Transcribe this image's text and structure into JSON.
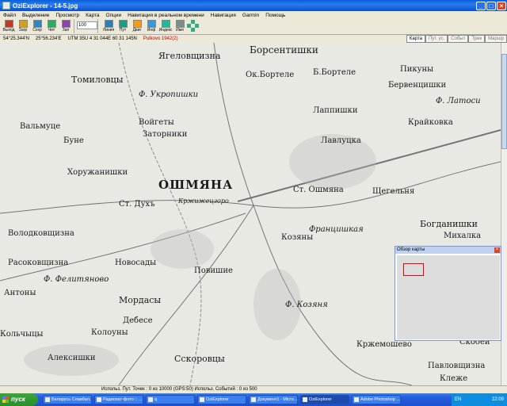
{
  "window": {
    "title": "OziExplorer - 14-5.jpg"
  },
  "menu": [
    "Файл",
    "Выделение",
    "Просмотр",
    "Карта",
    "Опции",
    "Навигация в реальном времени",
    "Навигация",
    "Garmin",
    "Помощь"
  ],
  "toolbar": {
    "buttons": [
      {
        "label": "Выход",
        "color": "#c0392b"
      },
      {
        "label": "Загр",
        "color": "#d4a017"
      },
      {
        "label": "Сохр",
        "color": "#2e86c1"
      },
      {
        "label": "Чит",
        "color": "#27ae60"
      },
      {
        "label": "Зап",
        "color": "#8e44ad"
      }
    ],
    "view_buttons": [
      {
        "label": "Линия",
        "color": "#2980b9"
      },
      {
        "label": "Пут",
        "color": "#16a085"
      },
      {
        "label": "Двиг",
        "color": "#f39c12"
      },
      {
        "label": "Инф",
        "color": "#3498db"
      },
      {
        "label": "Индекс",
        "color": "#1abc9c"
      },
      {
        "label": "Имя",
        "color": "#7f8c8d"
      }
    ],
    "zoom": "100"
  },
  "info": {
    "lat": "54°25.344'N",
    "lon": "25°56.234'E",
    "utm": "UTM 35U 4 31 044E 60 31 145N",
    "datum": "Pulkovo 1942(2)"
  },
  "right_tabs": [
    "Карта",
    "Пут. ус.",
    "Событ",
    "Трек",
    "Маршр"
  ],
  "map": {
    "labels": [
      {
        "text": "Ягеловщизна",
        "cls": ""
      },
      {
        "text": "Борсентишки",
        "cls": ""
      },
      {
        "text": "Томиловцы",
        "cls": ""
      },
      {
        "text": "Ф. Укропишки",
        "cls": "italic"
      },
      {
        "text": "Ок.Бортеле",
        "cls": ""
      },
      {
        "text": "Б.Бортеле",
        "cls": ""
      },
      {
        "text": "Пикуны",
        "cls": ""
      },
      {
        "text": "Бервенцишки",
        "cls": ""
      },
      {
        "text": "Ф. Латоси",
        "cls": "italic"
      },
      {
        "text": "Вальмуце",
        "cls": ""
      },
      {
        "text": "Буне",
        "cls": ""
      },
      {
        "text": "Войгеты",
        "cls": ""
      },
      {
        "text": "Заторники",
        "cls": ""
      },
      {
        "text": "Лаппишки",
        "cls": ""
      },
      {
        "text": "Лавлуцка",
        "cls": ""
      },
      {
        "text": "Крайковка",
        "cls": ""
      },
      {
        "text": "Хоружанишки",
        "cls": ""
      },
      {
        "text": "ОШМЯНА",
        "cls": "big"
      },
      {
        "text": "Ст. Ошмяна",
        "cls": ""
      },
      {
        "text": "Щегельня",
        "cls": ""
      },
      {
        "text": "Ст. Духъ",
        "cls": ""
      },
      {
        "text": "Кржижецгоро",
        "cls": "italic"
      },
      {
        "text": "Богданишки",
        "cls": ""
      },
      {
        "text": "Михалка",
        "cls": ""
      },
      {
        "text": "Володковщизна",
        "cls": ""
      },
      {
        "text": "Францишкая",
        "cls": "italic"
      },
      {
        "text": "Козяны",
        "cls": ""
      },
      {
        "text": "Расоковщизна",
        "cls": ""
      },
      {
        "text": "Новосады",
        "cls": ""
      },
      {
        "text": "Ф. Фелитяново",
        "cls": "italic"
      },
      {
        "text": "Повишие",
        "cls": ""
      },
      {
        "text": "Антоны",
        "cls": ""
      },
      {
        "text": "Мордасы",
        "cls": ""
      },
      {
        "text": "Дебесе",
        "cls": ""
      },
      {
        "text": "Кольчыцы",
        "cls": ""
      },
      {
        "text": "Колоуны",
        "cls": ""
      },
      {
        "text": "Алексишки",
        "cls": ""
      },
      {
        "text": "Сскоровцы",
        "cls": ""
      },
      {
        "text": "Ф. Козяня",
        "cls": "italic"
      },
      {
        "text": "Кржемошево",
        "cls": ""
      },
      {
        "text": "Скобей",
        "cls": ""
      },
      {
        "text": "Павловщизна",
        "cls": ""
      },
      {
        "text": "Клеже",
        "cls": ""
      }
    ]
  },
  "overview": {
    "title": "Обзор карты"
  },
  "status": {
    "text": "Использ. Пут. Точек : 0 из 10000  (GPS:50)  Использ. Событий : 0 из 500"
  },
  "taskbar": {
    "start": "пуск",
    "tasks": [
      "Беларусь Славбал...",
      "Радиохат-фото :: ...",
      "q",
      "OziExplorer",
      "Документ1 - Micro...",
      "OziExplorer",
      "Adobe Photoshop ..."
    ],
    "active_task": 5,
    "lang": "EN",
    "time": "22:09"
  },
  "colors": {
    "map_bg": "#e9e9e4",
    "titlebar": "#0a5fd8",
    "taskbar": "#245edc"
  }
}
